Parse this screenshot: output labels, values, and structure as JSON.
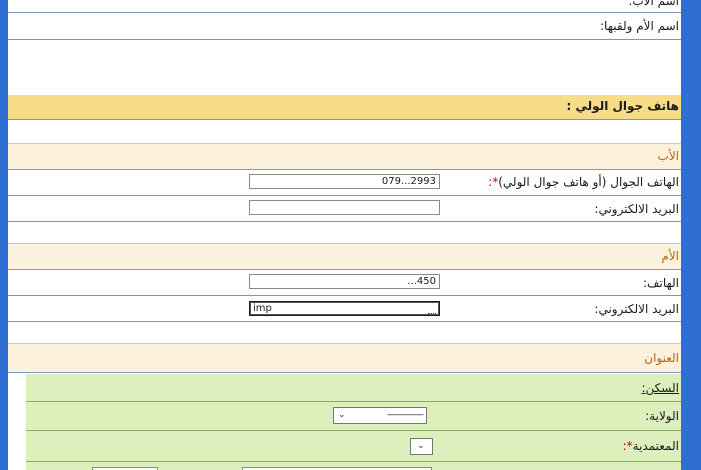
{
  "guardian": {
    "father_name_label": "اسم الأب:",
    "mother_name_label": "اسم الأم ولقبها:",
    "guardian_mobile_label": "هاتف جوال الولي :"
  },
  "father_section": {
    "title": "الأب",
    "mobile_label": "الهاتف الجوال (أو هاتف جوال الولي)",
    "required_mark": "*:",
    "mobile_value": "079...2993",
    "email_label": "البريد الالكتروني:"
  },
  "mother_section": {
    "title": "الأم",
    "phone_label": "الهاتف:",
    "phone_value": "...450",
    "email_label": "البريد الالكتروني:",
    "email_value": "imp"
  },
  "address_section": {
    "title": "العنوان",
    "residence_label": "السكن:",
    "state_label": "الولاية:",
    "state_selected": "----------------",
    "delegation_label": "المعتمدية",
    "delegation_required": "*:"
  }
}
